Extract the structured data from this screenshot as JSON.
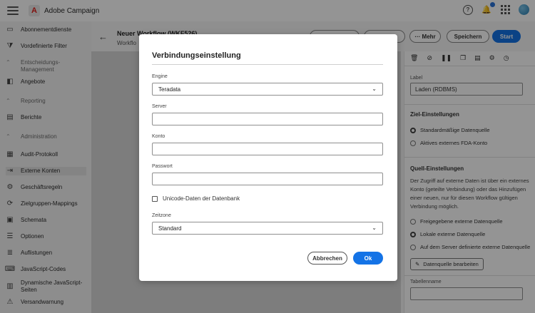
{
  "app": {
    "title": "Adobe Campaign",
    "logo_letter": "A"
  },
  "topbar_icons": [
    "hamburger-icon",
    "help-icon",
    "bell-icon",
    "apps-grid-icon",
    "avatar"
  ],
  "sidebar": {
    "items": [
      {
        "label": "Abonnementdienste",
        "icon": "subscription-icon",
        "glyph": "▭"
      },
      {
        "label": "Vordefinierte Filter",
        "icon": "filter-icon",
        "glyph": "⧩"
      },
      {
        "label": "Entscheidungs-Management",
        "section": true
      },
      {
        "label": "Angebote",
        "icon": "offers-icon",
        "glyph": "◧"
      },
      {
        "label": "Reporting",
        "section": true
      },
      {
        "label": "Berichte",
        "icon": "report-icon",
        "glyph": "▤"
      },
      {
        "label": "Administration",
        "section": true
      },
      {
        "label": "Audit-Protokoll",
        "icon": "audit-icon",
        "glyph": "▦"
      },
      {
        "label": "Externe Konten",
        "icon": "external-accounts-icon",
        "glyph": "⇥"
      },
      {
        "label": "Geschäftsregeln",
        "icon": "rules-icon",
        "glyph": "⚙"
      },
      {
        "label": "Zielgruppen-Mappings",
        "icon": "mapping-icon",
        "glyph": "⟳"
      },
      {
        "label": "Schemata",
        "icon": "schema-icon",
        "glyph": "▣"
      },
      {
        "label": "Optionen",
        "icon": "options-icon",
        "glyph": "☰"
      },
      {
        "label": "Auflistungen",
        "icon": "list-icon",
        "glyph": "≣"
      },
      {
        "label": "JavaScript-Codes",
        "icon": "code-icon",
        "glyph": "⌨"
      },
      {
        "label": "Dynamische JavaScript-Seiten",
        "icon": "pages-icon",
        "glyph": "▥"
      },
      {
        "label": "Versandwarnung",
        "icon": "warning-icon",
        "glyph": "⚠"
      }
    ],
    "active_index": 8
  },
  "main": {
    "title": "Neuer Workflow (WKF526)",
    "subtitle": "Workflo",
    "buttons": {
      "more": "··· Mehr",
      "save": "Speichern",
      "start": "Start"
    }
  },
  "right_panel": {
    "label_title": "Label",
    "label_value": "Laden (RDBMS)",
    "target_heading": "Ziel-Einstellungen",
    "target_options": [
      "Standardmäßige Datenquelle",
      "Aktives externes FDA-Konto"
    ],
    "target_selected": 0,
    "source_heading": "Quell-Einstellungen",
    "source_text": "Der Zugriff auf externe Daten ist über ein externes Konto (geteilte Verbindung) oder das Hinzufügen einer neuen, nur für diesen Workflow gültigen Verbindung möglich.",
    "source_options": [
      "Freigegebene externe Datenquelle",
      "Lokale externe Datenquelle",
      "Auf dem Server definierte externe Datenquelle"
    ],
    "source_selected": 1,
    "edit_button": "Datenquelle bearbeiten",
    "table_label": "Tabellenname"
  },
  "dialog": {
    "title": "Verbindungseinstellung",
    "engine_label": "Engine",
    "engine_value": "Teradata",
    "server_label": "Server",
    "server_value": "",
    "account_label": "Konto",
    "account_value": "",
    "password_label": "Passwort",
    "password_value": "",
    "unicode_label": "Unicode-Daten der Datenbank",
    "timezone_label": "Zeitzone",
    "timezone_value": "Standard",
    "cancel_label": "Abbrechen",
    "ok_label": "Ok"
  },
  "colors": {
    "accent": "#1473e6",
    "brand": "#e0201b"
  }
}
